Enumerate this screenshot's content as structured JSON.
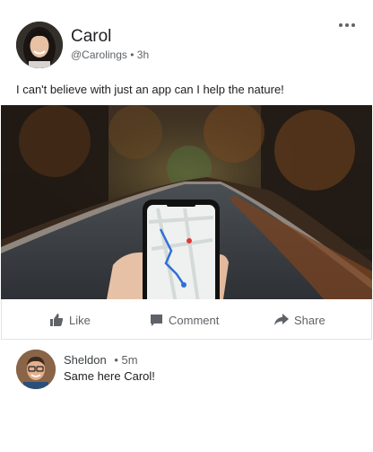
{
  "post": {
    "author_name": "Carol",
    "handle": "@Carolings",
    "separator": "•",
    "time": "3h",
    "text": "I can't believe with just an app can I help the nature!",
    "icons": {
      "menu": "more-horizontal-icon"
    }
  },
  "actions": {
    "like_label": "Like",
    "comment_label": "Comment",
    "share_label": "Share",
    "icons": {
      "like": "thumbs-up-icon",
      "comment": "comment-icon",
      "share": "share-arrow-icon"
    }
  },
  "comment": {
    "author_name": "Sheldon",
    "separator": "•",
    "time": "5m",
    "text": "Same here Carol!"
  },
  "colors": {
    "text_primary": "#202124",
    "text_secondary": "#5f6368",
    "divider": "#e3e3e3"
  }
}
